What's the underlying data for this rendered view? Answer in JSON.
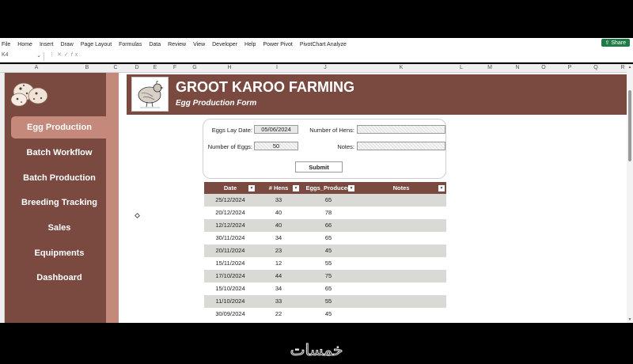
{
  "ribbon": {
    "tabs": [
      "File",
      "Home",
      "Insert",
      "Draw",
      "Page Layout",
      "Formulas",
      "Data",
      "Review",
      "View",
      "Developer",
      "Help",
      "Power Pivot",
      "PivotChart Analyze"
    ],
    "share_label": "Share"
  },
  "formula_bar": {
    "name_box": "K4",
    "fx": "fx"
  },
  "columns": [
    "A",
    "B",
    "C",
    "D",
    "E",
    "F",
    "G",
    "H",
    "I",
    "J",
    "K",
    "L",
    "M",
    "N",
    "O",
    "P",
    "Q",
    "R"
  ],
  "sidebar": {
    "items": [
      {
        "label": "Egg Production",
        "active": true
      },
      {
        "label": "Batch Workflow",
        "active": false
      },
      {
        "label": "Batch Production",
        "active": false
      },
      {
        "label": "Breeding Tracking",
        "active": false
      },
      {
        "label": "Sales",
        "active": false
      },
      {
        "label": "Equipments",
        "active": false
      },
      {
        "label": "Dashboard",
        "active": false
      }
    ]
  },
  "header": {
    "title": "GROOT KAROO FARMING",
    "subtitle": "Egg Production Form"
  },
  "form": {
    "eggs_lay_date_label": "Eggs Lay Date:",
    "eggs_lay_date_value": "05/06/2024",
    "number_of_hens_label": "Number of Hens:",
    "number_of_hens_value": "",
    "number_of_eggs_label": "Number of Eggs:",
    "number_of_eggs_value": "50",
    "notes_label": "Notes:",
    "notes_value": "",
    "submit_label": "Submit"
  },
  "table": {
    "headers": [
      "Date",
      "# Hens",
      "Eggs_Produced",
      "Notes"
    ],
    "rows": [
      [
        "25/12/2024",
        "33",
        "65",
        ""
      ],
      [
        "20/12/2024",
        "40",
        "78",
        ""
      ],
      [
        "12/12/2024",
        "40",
        "66",
        ""
      ],
      [
        "30/11/2024",
        "34",
        "65",
        ""
      ],
      [
        "20/11/2024",
        "23",
        "45",
        ""
      ],
      [
        "15/11/2024",
        "12",
        "55",
        ""
      ],
      [
        "17/10/2024",
        "44",
        "75",
        ""
      ],
      [
        "15/10/2024",
        "34",
        "65",
        ""
      ],
      [
        "11/10/2024",
        "33",
        "55",
        ""
      ],
      [
        "30/09/2024",
        "22",
        "45",
        ""
      ]
    ]
  },
  "colors": {
    "brand_brown": "#7a4a40",
    "accent_rose": "#c4897a",
    "row_shade": "#d9d9d5"
  },
  "watermark": "خمسات"
}
